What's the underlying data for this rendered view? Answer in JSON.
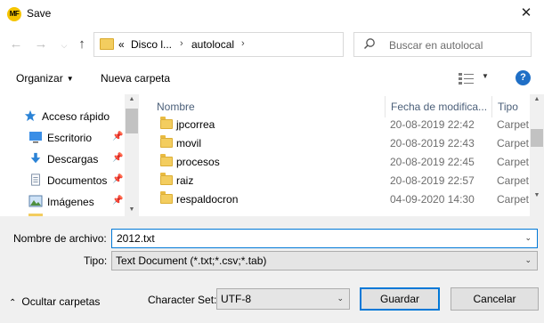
{
  "window": {
    "app_icon_text": "MF",
    "title": "Save",
    "close_glyph": "✕"
  },
  "address_bar": {
    "overflow": "«",
    "crumbs": [
      "Disco l...",
      "autolocal"
    ],
    "search_placeholder": "Buscar en autolocal"
  },
  "toolbar": {
    "organize_label": "Organizar",
    "new_folder_label": "Nueva carpeta",
    "help_glyph": "?"
  },
  "nav_pane": {
    "items": [
      {
        "label": "Acceso rápido",
        "icon": "star-icon",
        "pinned": false
      },
      {
        "label": "Escritorio",
        "icon": "desktop-icon",
        "pinned": true
      },
      {
        "label": "Descargas",
        "icon": "download-icon",
        "pinned": true
      },
      {
        "label": "Documentos",
        "icon": "documents-icon",
        "pinned": true
      },
      {
        "label": "Imágenes",
        "icon": "pictures-icon",
        "pinned": true
      }
    ]
  },
  "file_list": {
    "columns": [
      "Nombre",
      "Fecha de modifica...",
      "Tipo"
    ],
    "rows": [
      {
        "name": "jpcorrea",
        "date": "20-08-2019 22:42",
        "type": "Carpet"
      },
      {
        "name": "movil",
        "date": "20-08-2019 22:43",
        "type": "Carpet"
      },
      {
        "name": "procesos",
        "date": "20-08-2019 22:45",
        "type": "Carpet"
      },
      {
        "name": "raiz",
        "date": "20-08-2019 22:57",
        "type": "Carpet"
      },
      {
        "name": "respaldocron",
        "date": "04-09-2020 14:30",
        "type": "Carpet"
      }
    ]
  },
  "form": {
    "filename_label": "Nombre de archivo:",
    "filename_value": "2012.txt",
    "type_label": "Tipo:",
    "type_value": "Text Document (*.txt;*.csv;*.tab)",
    "charset_label": "Character Set:",
    "charset_value": "UTF-8",
    "hide_folders_label": "Ocultar carpetas",
    "save_label": "Guardar",
    "cancel_label": "Cancelar"
  },
  "colors": {
    "accent": "#0078d7",
    "folder": "#f3cd5f",
    "help": "#1f6fc6"
  }
}
